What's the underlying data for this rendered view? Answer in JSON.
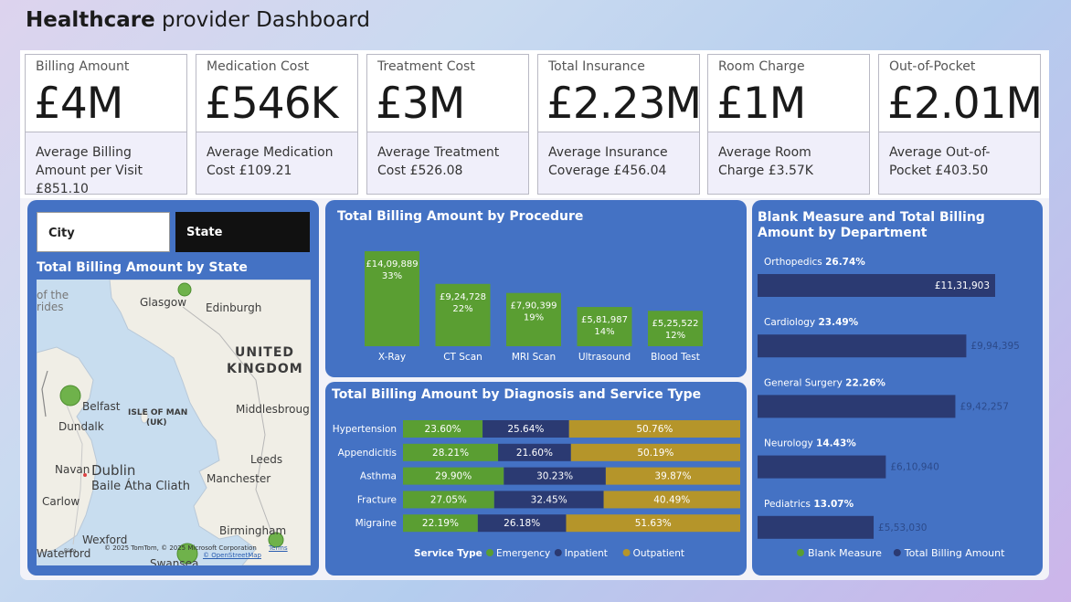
{
  "header": {
    "title_bold": "Healthcare",
    "title_rest": " provider Dashboard"
  },
  "kpis": [
    {
      "label": "Billing Amount",
      "value": "£4M",
      "sub": "Average Billing Amount per Visit £851.10"
    },
    {
      "label": "Medication Cost",
      "value": "£546K",
      "sub": "Average Medication Cost £109.21"
    },
    {
      "label": "Treatment Cost",
      "value": "£3M",
      "sub": "Average Treatment Cost £526.08"
    },
    {
      "label": "Total Insurance",
      "value": "£2.23M",
      "sub": "Average Insurance Coverage £456.04"
    },
    {
      "label": "Room Charge",
      "value": "£1M",
      "sub": "Average Room Charge £3.57K"
    },
    {
      "label": "Out-of-Pocket",
      "value": "£2.01M",
      "sub": "Average Out-of-Pocket £403.50"
    }
  ],
  "slicers": {
    "city": "City",
    "state": "State"
  },
  "map": {
    "title": "Total Billing Amount by State",
    "labels": {
      "glasgow": "Glasgow",
      "edinburgh": "Edinburgh",
      "uk1": "UNITED",
      "uk2": "KINGDOM",
      "belfast": "Belfast",
      "isle1": "ISLE OF MAN",
      "isle2": "(UK)",
      "dundalk": "Dundalk",
      "middlesbrough": "Middlesbroug",
      "dublin": "Dublin",
      "baile": "Baile Átha Cliath",
      "navan": "Navan",
      "leeds": "Leeds",
      "manchester": "Manchester",
      "carlow": "Carlow",
      "wexford": "Wexford",
      "birmingham": "Birmingham",
      "swansea": "Swansea",
      "waterford": "Waterford",
      "ofthe": "of the",
      "rides": "rides"
    },
    "attribution": "© 2025 TomTom, © 2025 Microsoft Corporation",
    "terms": "Terms",
    "osm": "© OpenStreetMap",
    "bing": "Bing"
  },
  "chart_data": [
    {
      "type": "bar",
      "title": "Total Billing Amount by Procedure",
      "categories": [
        "X-Ray",
        "CT Scan",
        "MRI Scan",
        "Ultrasound",
        "Blood Test"
      ],
      "values": [
        1409889,
        924728,
        790399,
        581987,
        525522
      ],
      "value_labels": [
        "£14,09,889",
        "£9,24,728",
        "£7,90,399",
        "£5,81,987",
        "£5,25,522"
      ],
      "percent_labels": [
        "33%",
        "22%",
        "19%",
        "14%",
        "12%"
      ],
      "color": "#5a9e32"
    },
    {
      "type": "bar",
      "stacked": "100%",
      "orientation": "horizontal",
      "title": "Total Billing Amount by Diagnosis and Service Type",
      "categories": [
        "Hypertension",
        "Appendicitis",
        "Asthma",
        "Fracture",
        "Migraine"
      ],
      "legend_title": "Service Type",
      "series": [
        {
          "name": "Emergency",
          "color": "#5a9e32",
          "values": [
            23.6,
            28.21,
            29.9,
            27.05,
            22.19
          ],
          "labels": [
            "23.60%",
            "28.21%",
            "29.90%",
            "27.05%",
            "22.19%"
          ]
        },
        {
          "name": "Inpatient",
          "color": "#2b3a72",
          "values": [
            25.64,
            21.6,
            30.23,
            32.45,
            26.18
          ],
          "labels": [
            "25.64%",
            "21.60%",
            "30.23%",
            "32.45%",
            "26.18%"
          ]
        },
        {
          "name": "Outpatient",
          "color": "#b5952a",
          "values": [
            50.76,
            50.19,
            39.87,
            40.49,
            51.63
          ],
          "labels": [
            "50.76%",
            "50.19%",
            "39.87%",
            "40.49%",
            "51.63%"
          ]
        }
      ]
    },
    {
      "type": "bar",
      "orientation": "horizontal",
      "title": "Blank Measure and Total Billing Amount by Department",
      "categories": [
        "Orthopedics",
        "Cardiology",
        "General Surgery",
        "Neurology",
        "Pediatrics"
      ],
      "percent_labels": [
        "26.74%",
        "23.49%",
        "22.26%",
        "14.43%",
        "13.07%"
      ],
      "values": [
        1131903,
        994395,
        942257,
        610940,
        553030
      ],
      "value_labels": [
        "£11,31,903",
        "£9,94,395",
        "£9,42,257",
        "£6,10,940",
        "£5,53,030"
      ],
      "series_names": [
        "Blank Measure",
        "Total Billing Amount"
      ],
      "colors": {
        "Blank Measure": "#5a9e32",
        "Total Billing Amount": "#2b3a72"
      }
    }
  ]
}
